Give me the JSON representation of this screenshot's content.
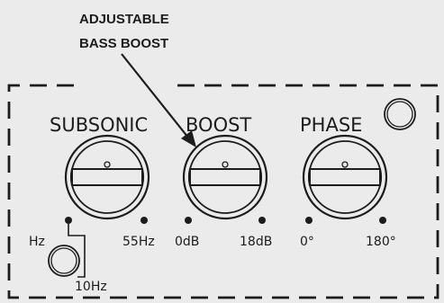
{
  "callout": {
    "line1": "ADJUSTABLE",
    "line2": "BASS BOOST"
  },
  "knobs": {
    "subsonic": {
      "label": "SUBSONIC",
      "min_label": "Hz",
      "mid_label": "10Hz",
      "max_label": "55Hz"
    },
    "boost": {
      "label": "BOOST",
      "min_label": "0dB",
      "max_label": "18dB"
    },
    "phase": {
      "label": "PHASE",
      "min_label": "0°",
      "max_label": "180°"
    }
  },
  "icons": {
    "indicator_top": "led-indicator-icon",
    "indicator_bottom": "led-indicator-icon"
  },
  "colors": {
    "background": "#ebebeb",
    "ink": "#1c1c1c"
  }
}
